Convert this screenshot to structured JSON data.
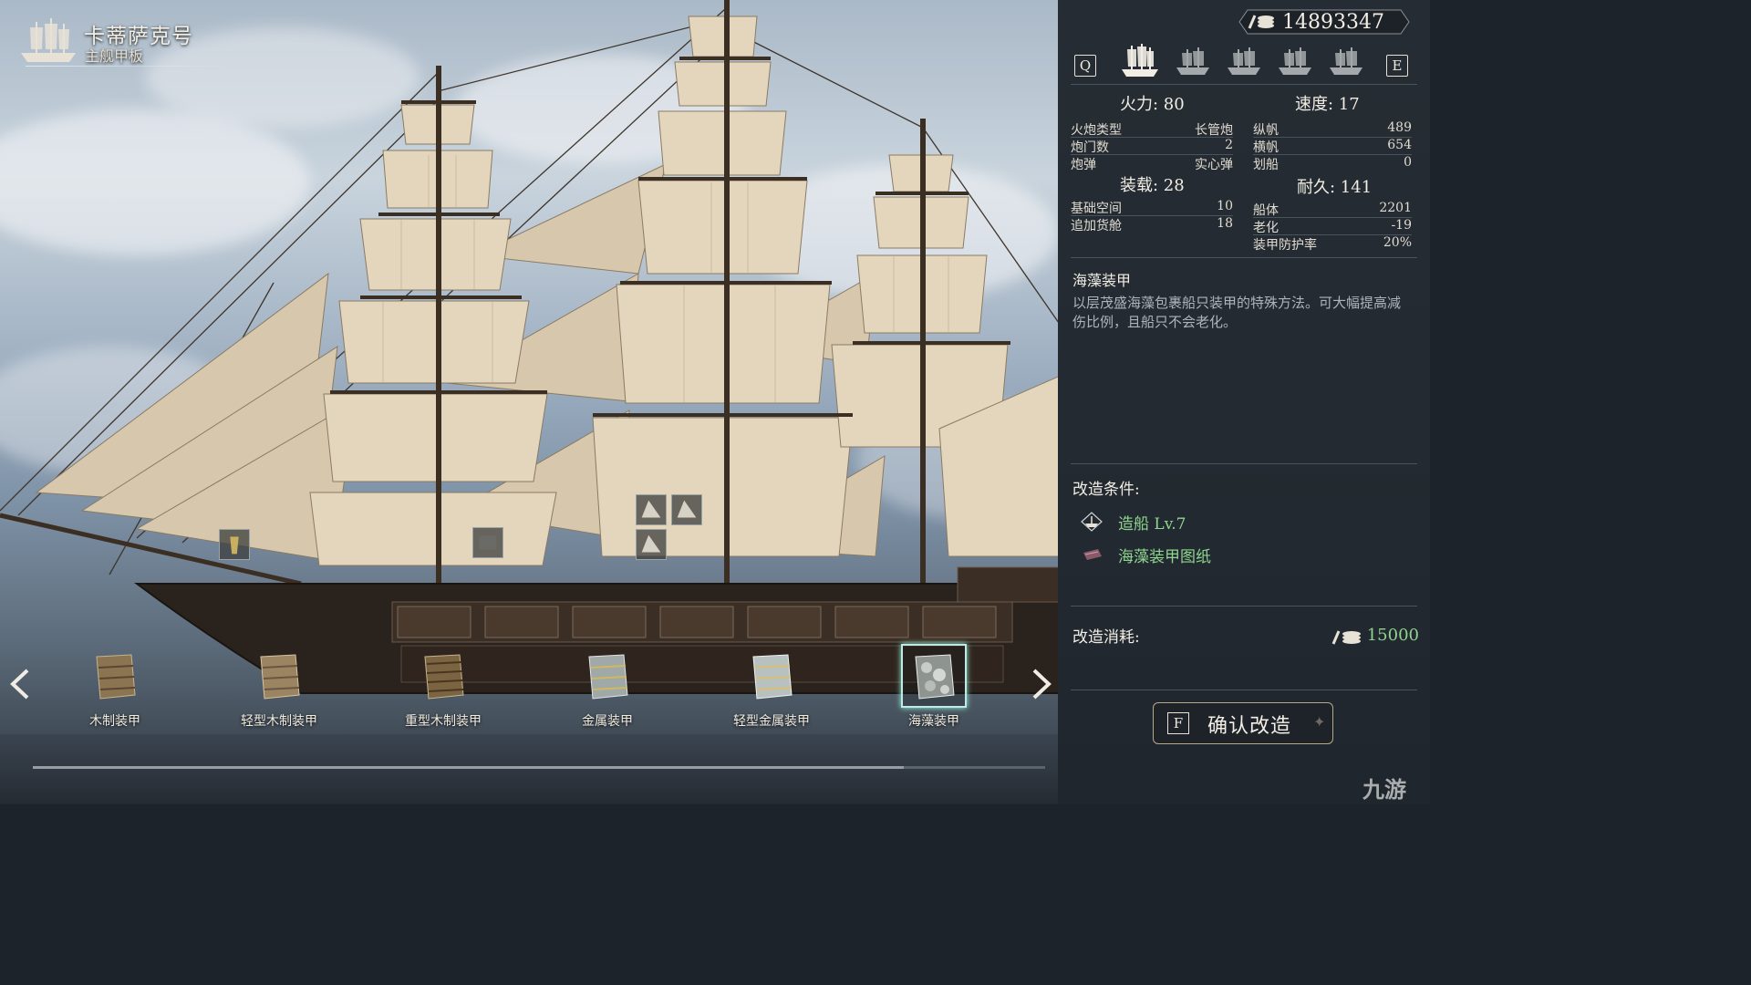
{
  "header": {
    "ship_name": "卡蒂萨克号",
    "deck": "主舰甲板"
  },
  "currency": {
    "amount": "14893347",
    "icon": "coin-stack-icon"
  },
  "ship_tabs": {
    "prev_key": "Q",
    "next_key": "E",
    "count": 5,
    "selected_index": 0
  },
  "stats": {
    "firepower": {
      "label": "火力: 80"
    },
    "speed": {
      "label": "速度: 17"
    },
    "left_rows": [
      {
        "k": "火炮类型",
        "v": "长管炮"
      },
      {
        "k": "炮门数",
        "v": "2"
      },
      {
        "k": "炮弹",
        "v": "实心弹"
      }
    ],
    "right_rows": [
      {
        "k": "纵帆",
        "v": "489"
      },
      {
        "k": "横帆",
        "v": "654"
      },
      {
        "k": "划船",
        "v": "0"
      }
    ],
    "cargo": {
      "label": "装载: 28"
    },
    "durability": {
      "label": "耐久: 141"
    },
    "cargo_rows": [
      {
        "k": "基础空间",
        "v": "10"
      },
      {
        "k": "追加货舱",
        "v": "18"
      }
    ],
    "durability_rows": [
      {
        "k": "船体",
        "v": "2201"
      },
      {
        "k": "老化",
        "v": "-19"
      },
      {
        "k": "装甲防护率",
        "v": "20%"
      }
    ]
  },
  "description": {
    "title": "海藻装甲",
    "text": "以层茂盛海藻包裹船只装甲的特殊方法。可大幅提高减伤比例，且船只不会老化。"
  },
  "conditions": {
    "heading": "改造条件:",
    "items": [
      {
        "label": "造船 Lv.7",
        "icon": "shipbuilding-icon"
      },
      {
        "label": "海藻装甲图纸",
        "icon": "blueprint-icon"
      }
    ]
  },
  "cost": {
    "heading": "改造消耗:",
    "value": "15000",
    "icon": "coin-stack-icon"
  },
  "confirm": {
    "key": "F",
    "label": "确认改造"
  },
  "armors": [
    {
      "label": "木制装甲"
    },
    {
      "label": "轻型木制装甲"
    },
    {
      "label": "重型木制装甲"
    },
    {
      "label": "金属装甲"
    },
    {
      "label": "轻型金属装甲"
    },
    {
      "label": "海藻装甲"
    }
  ],
  "selected_armor": "海藻装甲",
  "watermark": "九游",
  "colors": {
    "accent_green": "#8fd48f",
    "panel_bg": "#242b32",
    "selected_frame": "#bfe8e8"
  }
}
